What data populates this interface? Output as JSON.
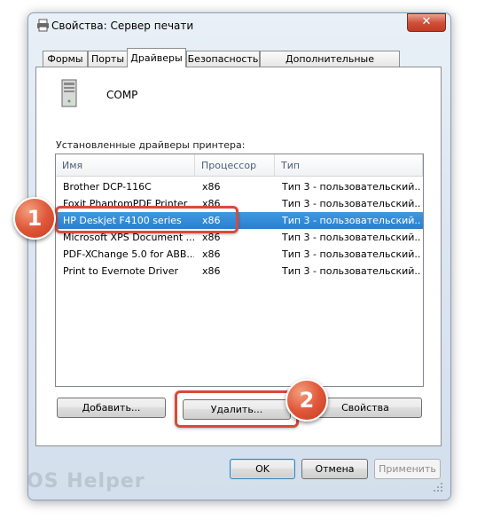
{
  "window": {
    "title": "Свойства: Сервер печати"
  },
  "tabs": [
    {
      "label": "Формы"
    },
    {
      "label": "Порты"
    },
    {
      "label": "Драйверы"
    },
    {
      "label": "Безопасность"
    },
    {
      "label": "Дополнительные параметры"
    }
  ],
  "server": {
    "name": "COMP"
  },
  "drivers_label": "Установленные драйверы принтера:",
  "table": {
    "columns": [
      "Имя",
      "Процессор",
      "Тип"
    ],
    "rows": [
      [
        "Brother DCP-116C",
        "x86",
        "Тип 3 - пользовательский..."
      ],
      [
        "Foxit PhantomPDF Printer",
        "x86",
        "Тип 3 - пользовательский..."
      ],
      [
        "HP Deskjet F4100 series",
        "x86",
        "Тип 3 - пользовательский..."
      ],
      [
        "Microsoft XPS Document ...",
        "x86",
        "Тип 3 - пользовательский..."
      ],
      [
        "PDF-XChange 5.0 for ABB...",
        "x86",
        "Тип 3 - пользовательский..."
      ],
      [
        "Print to Evernote Driver",
        "x86",
        "Тип 3 - пользовательский..."
      ]
    ],
    "selected_row": 2
  },
  "buttons": {
    "add": "Добавить...",
    "remove": "Удалить...",
    "properties": "Свойства",
    "ok": "OK",
    "cancel": "Отмена",
    "apply": "Применить"
  },
  "annotations": {
    "step1": "1",
    "step2": "2"
  },
  "watermark": "OS Helper",
  "colors": {
    "selection": "#3399e0",
    "callout": "#e0573a"
  }
}
